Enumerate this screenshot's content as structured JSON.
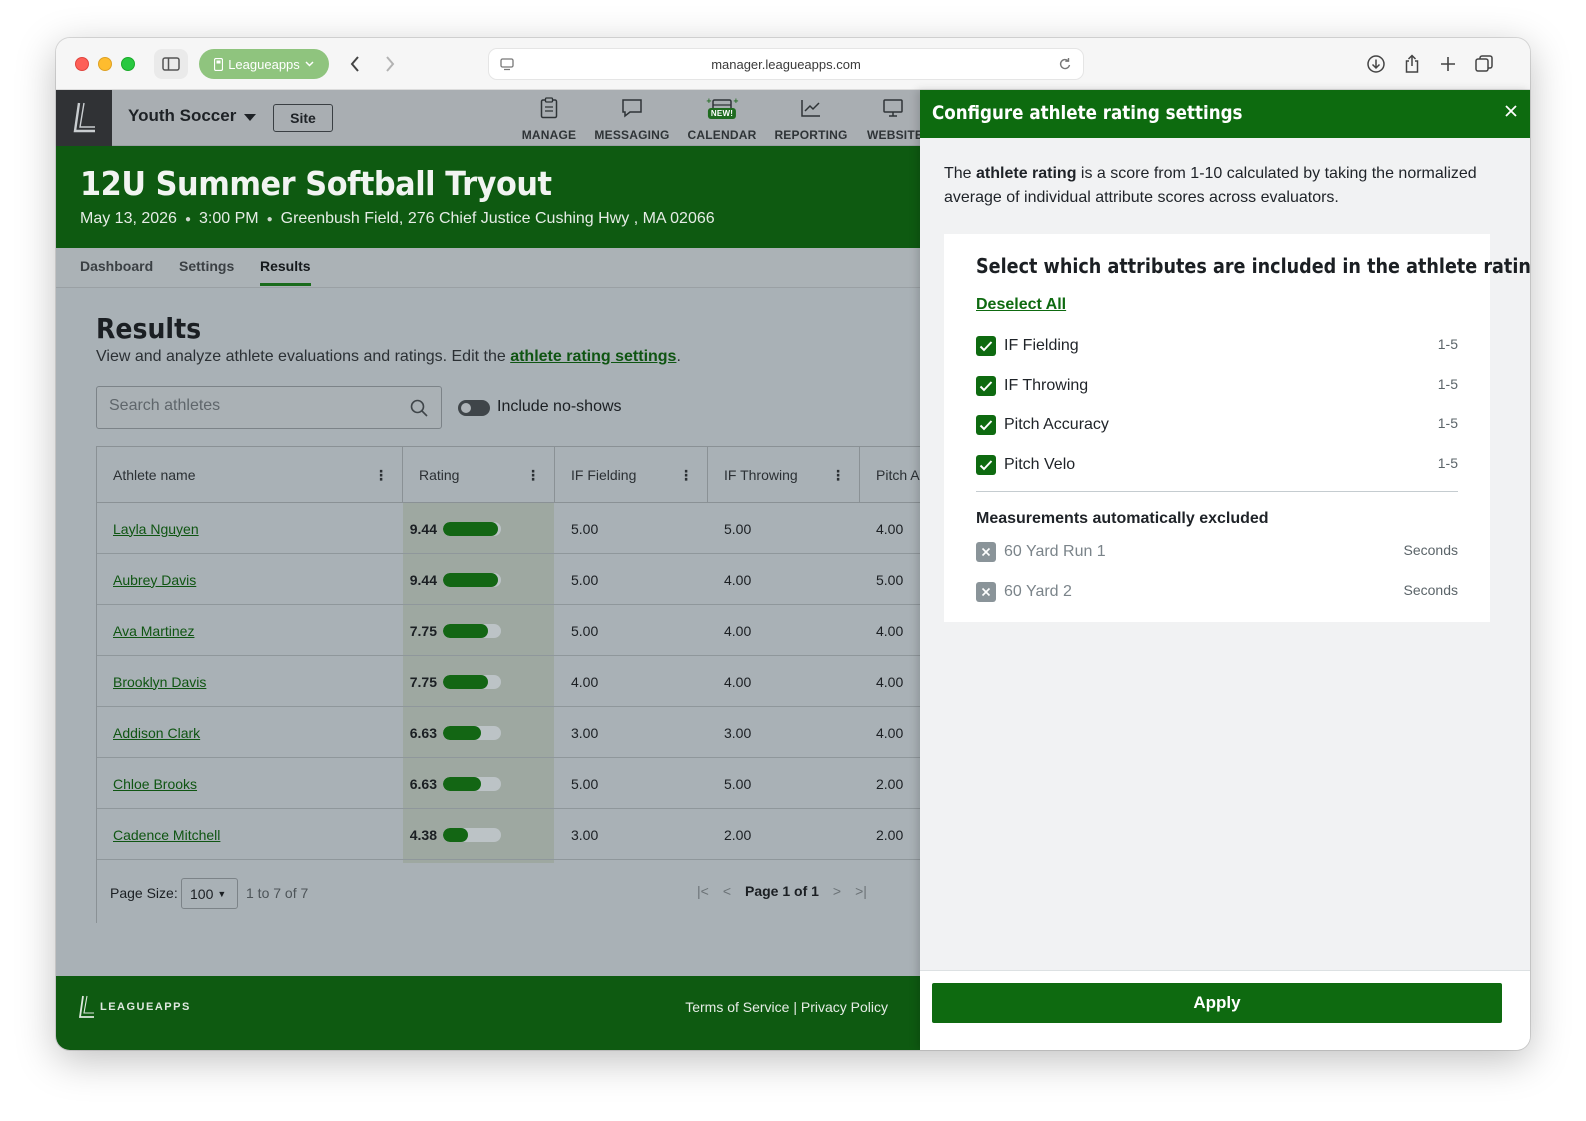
{
  "browser": {
    "profile_label": "Leagueapps",
    "url": "manager.leagueapps.com"
  },
  "topbar": {
    "org_name": "Youth Soccer",
    "site_label": "Site",
    "nav": [
      {
        "label": "MANAGE",
        "icon": "clipboard-icon"
      },
      {
        "label": "MESSAGING",
        "icon": "chat-icon"
      },
      {
        "label": "CALENDAR",
        "icon": "calendar-icon",
        "badge": "NEW!"
      },
      {
        "label": "REPORTING",
        "icon": "chart-icon"
      },
      {
        "label": "WEBSITE",
        "icon": "monitor-icon"
      }
    ]
  },
  "event": {
    "title": "12U Summer Softball Tryout",
    "date": "May 13, 2026",
    "time": "3:00 PM",
    "location": "Greenbush Field, 276 Chief Justice Cushing Hwy , MA 02066"
  },
  "tabs": [
    "Dashboard",
    "Settings",
    "Results"
  ],
  "results": {
    "title": "Results",
    "desc_prefix": "View and analyze athlete evaluations and ratings. Edit the ",
    "desc_link": "athlete rating settings",
    "desc_suffix": ".",
    "search_placeholder": "Search athletes",
    "toggle_label": "Include no-shows"
  },
  "grid": {
    "columns": [
      "Athlete name",
      "Rating",
      "IF Fielding",
      "IF Throwing",
      "Pitch A"
    ],
    "rows": [
      {
        "name": "Layla Nguyen",
        "rating": "9.44",
        "rating_pct": 0.944,
        "if_fielding": "5.00",
        "if_throwing": "5.00",
        "pitch_acc": "4.00"
      },
      {
        "name": "Aubrey Davis",
        "rating": "9.44",
        "rating_pct": 0.944,
        "if_fielding": "5.00",
        "if_throwing": "4.00",
        "pitch_acc": "5.00"
      },
      {
        "name": "Ava Martinez",
        "rating": "7.75",
        "rating_pct": 0.775,
        "if_fielding": "5.00",
        "if_throwing": "4.00",
        "pitch_acc": "4.00"
      },
      {
        "name": "Brooklyn Davis",
        "rating": "7.75",
        "rating_pct": 0.775,
        "if_fielding": "4.00",
        "if_throwing": "4.00",
        "pitch_acc": "4.00"
      },
      {
        "name": "Addison Clark",
        "rating": "6.63",
        "rating_pct": 0.663,
        "if_fielding": "3.00",
        "if_throwing": "3.00",
        "pitch_acc": "4.00"
      },
      {
        "name": "Chloe Brooks",
        "rating": "6.63",
        "rating_pct": 0.663,
        "if_fielding": "5.00",
        "if_throwing": "5.00",
        "pitch_acc": "2.00"
      },
      {
        "name": "Cadence Mitchell",
        "rating": "4.38",
        "rating_pct": 0.438,
        "if_fielding": "3.00",
        "if_throwing": "2.00",
        "pitch_acc": "2.00"
      }
    ],
    "footer": {
      "page_size_label": "Page Size:",
      "page_size_value": "100",
      "range_text": "1 to 7 of 7",
      "page_text": "Page 1 of 1"
    }
  },
  "footer": {
    "brand": "LEAGUEAPPS",
    "links": "Terms of Service | Privacy Policy"
  },
  "drawer": {
    "title": "Configure athlete rating settings",
    "intro_prefix": "The ",
    "intro_bold": "athlete rating",
    "intro_suffix": " is a score from 1-10 calculated by taking the normalized average of individual attribute scores across evaluators.",
    "card_title": "Select which attributes are included in the athlete rating.",
    "deselect_all": "Deselect All",
    "attributes": [
      {
        "label": "IF Fielding",
        "scale": "1-5",
        "checked": true
      },
      {
        "label": "IF Throwing",
        "scale": "1-5",
        "checked": true
      },
      {
        "label": "Pitch Accuracy",
        "scale": "1-5",
        "checked": true
      },
      {
        "label": "Pitch Velo",
        "scale": "1-5",
        "checked": true
      }
    ],
    "excluded_title": "Measurements automatically excluded",
    "excluded": [
      {
        "label": "60 Yard Run 1",
        "unit": "Seconds"
      },
      {
        "label": "60 Yard 2",
        "unit": "Seconds"
      }
    ],
    "apply_label": "Apply"
  },
  "colors": {
    "brand_green": "#0e6a10",
    "header_green": "#0e5a11"
  }
}
